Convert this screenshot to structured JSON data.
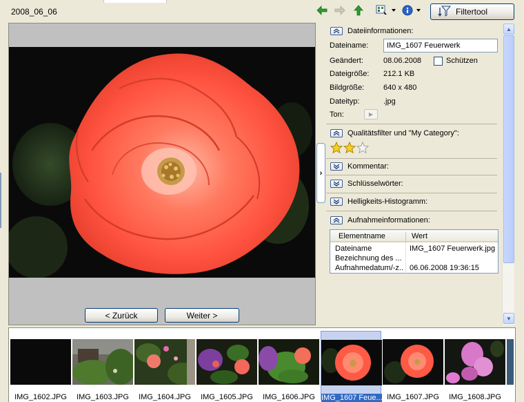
{
  "header": {
    "folder_title": "2008_06_06",
    "filter_button_label": "Filtertool"
  },
  "toolbar": {
    "icons": [
      "back-arrow-icon",
      "forward-arrow-icon",
      "up-arrow-icon",
      "view-mode-icon",
      "info-icon"
    ]
  },
  "viewer": {
    "back_button_label": "< Zurück",
    "next_button_label": "Weiter >"
  },
  "panel": {
    "file_info": {
      "title": "Dateiinformationen:",
      "filename_label": "Dateiname:",
      "filename_value": "IMG_1607 Feuerwerk",
      "modified_label": "Geändert:",
      "modified_value": "08.06.2008",
      "protect_label": "Schützen",
      "filesize_label": "Dateigröße:",
      "filesize_value": "212.1 KB",
      "imagesize_label": "Bildgröße:",
      "imagesize_value": "640 x 480",
      "filetype_label": "Dateityp:",
      "filetype_value": ".jpg",
      "sound_label": "Ton:"
    },
    "quality": {
      "title": "Qualitätsfilter und \"My Category\":",
      "rating": 2,
      "max_rating": 3
    },
    "comment_title": "Kommentar:",
    "keywords_title": "Schlüsselwörter:",
    "histogram_title": "Helligkeits-Histogramm:",
    "exif": {
      "title": "Aufnahmeinformationen:",
      "col_name": "Elementname",
      "col_value": "Wert",
      "rows": [
        {
          "name": "Dateiname",
          "value": "IMG_1607 Feuerwerk.jpg"
        },
        {
          "name": "Bezeichnung des ...",
          "value": ""
        },
        {
          "name": "Aufnahmedatum/-z...",
          "value": "06.06.2008 19:36:15"
        }
      ]
    }
  },
  "filmstrip": [
    {
      "caption": "IMG_1602.JPG"
    },
    {
      "caption": "IMG_1603.JPG"
    },
    {
      "caption": "IMG_1604.JPG"
    },
    {
      "caption": "IMG_1605.JPG"
    },
    {
      "caption": "IMG_1606.JPG"
    },
    {
      "caption": "IMG_1607 Feue...",
      "selected": true
    },
    {
      "caption": "IMG_1607.JPG"
    },
    {
      "caption": "IMG_1608.JPG"
    }
  ],
  "colors": {
    "accent": "#316ac5",
    "rose": "#ff5a45",
    "arrow_green": "#2f9a2f"
  }
}
